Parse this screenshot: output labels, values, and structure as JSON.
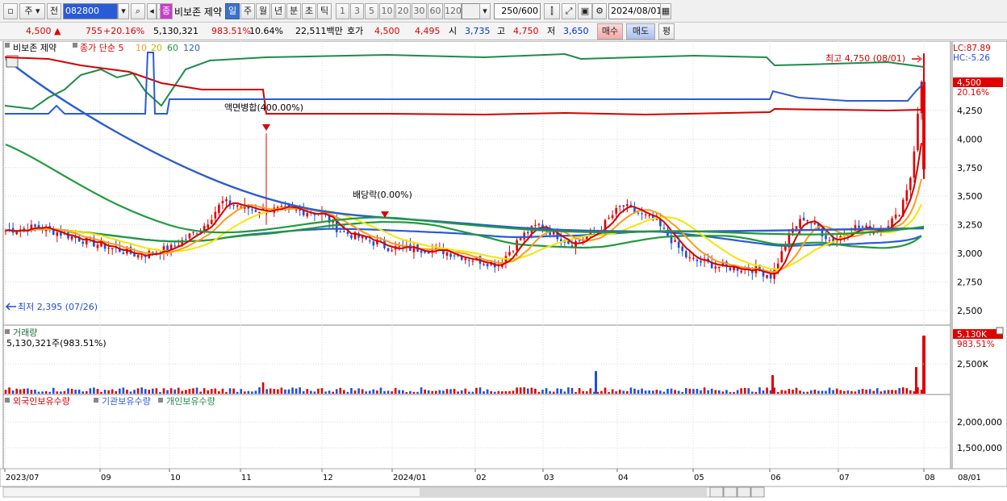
{
  "toolbar": {
    "market_label": "주",
    "prev_label": "전",
    "code_value": "082800",
    "stock_badge": "종",
    "stock_name": "비보존 제약",
    "period_tabs": [
      "일",
      "주",
      "월",
      "년",
      "분",
      "초",
      "틱"
    ],
    "active_period": "일",
    "interval_buttons": [
      "1",
      "3",
      "5",
      "10",
      "20",
      "30",
      "60",
      "120"
    ],
    "count_value": "250",
    "count_max": "/600",
    "date_value": "2024/08/01"
  },
  "quote": {
    "price": "4,500",
    "change": "755",
    "change_pct": "+20.16%",
    "volume": "5,130,321",
    "volume_pct": "983.51%",
    "turnover": "10.64%",
    "amount": "22,511백만",
    "bid_label": "호가",
    "bid_value": "4,500",
    "ask_value": "4,495",
    "open_label": "시",
    "open_value": "3,735",
    "high_label": "고",
    "high_value": "4,750",
    "low_label": "저",
    "low_value": "3,650",
    "buy_label": "매수",
    "sell_label": "매도",
    "eval_label": "평"
  },
  "chart_data": {
    "type": "candlestick",
    "price_panel": {
      "title": "비보존 제약",
      "ma_label": "종가 단순",
      "ma_periods": [
        "5",
        "10",
        "20",
        "60",
        "120"
      ],
      "ma_colors": [
        "#d40000",
        "#ff9a1a",
        "#f5e600",
        "#1f9a3a",
        "#2a5bd7"
      ],
      "y_ticks": [
        "4,250",
        "4,000",
        "3,750",
        "3,500",
        "3,250",
        "3,000",
        "2,750",
        "2,500"
      ],
      "ylim": [
        2400,
        4800
      ],
      "high_note": "최고 4,750 (08/01)",
      "low_note": "최저 2,395 (07/26)",
      "event_split": "액면병합(400.00%)",
      "event_dividend": "배당락(0.00%)",
      "lc_label": "LC:87.89",
      "hc_label": "HC:-5.26",
      "current_price": "4,500",
      "current_change": "20.16%"
    },
    "volume_panel": {
      "title": "거래량",
      "value_label": "5,130,321주(983.51%)",
      "y_ticks": [
        "2,500K"
      ],
      "current_volume": "5,130K",
      "current_pct": "983.51%"
    },
    "holding_panel": {
      "legends": [
        {
          "name": "외국인보유수량",
          "color": "#d40000"
        },
        {
          "name": "기관보유수량",
          "color": "#2a5bd7"
        },
        {
          "name": "개인보유수량",
          "color": "#1f8a4a"
        }
      ],
      "y_ticks": [
        "2,000,000",
        "1,500,000"
      ]
    },
    "x_ticks": [
      "2023/07",
      "09",
      "10",
      "11",
      "12",
      "2024/01",
      "02",
      "03",
      "04",
      "05",
      "06",
      "07",
      "08"
    ],
    "x_last_label": "08/01"
  }
}
